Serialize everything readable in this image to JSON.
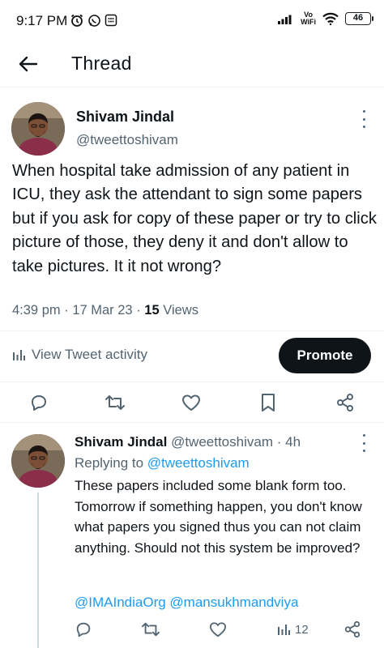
{
  "status_bar": {
    "time": "9:17 PM",
    "volte": "Vo",
    "wifi_label": "WiFi",
    "battery": "46",
    "icons": [
      "alarm-icon",
      "whatsapp-icon",
      "app-notification-icon",
      "signal-icon",
      "wifi-icon",
      "battery-icon"
    ]
  },
  "header": {
    "title": "Thread",
    "back_icon": "back-arrow-icon"
  },
  "main_tweet": {
    "author_name": "Shivam Jindal",
    "author_handle": "@tweettoshivam",
    "text": "When hospital take admission of any patient in ICU, they ask the attendant to sign some papers but if you ask for copy of these paper or try to click picture of those, they deny it and don't allow to take pictures. It it not wrong?",
    "time": "4:39 pm",
    "date": "17 Mar 23",
    "views_count": "15",
    "views_label": "Views",
    "activity_label": "View Tweet activity",
    "promote_label": "Promote",
    "actions": [
      "reply-icon",
      "retweet-icon",
      "like-icon",
      "bookmark-icon",
      "share-icon"
    ]
  },
  "reply_tweet": {
    "author_name": "Shivam Jindal",
    "author_handle": "@tweettoshivam",
    "age": "4h",
    "replying_prefix": "Replying to",
    "replying_handle": "@tweettoshivam",
    "text": "These papers included some blank form too. Tomorrow if something happen, you don't know what papers you signed thus you can not claim anything. Should not this system be improved?",
    "mention_1": "@IMAIndiaOrg",
    "mention_2": "@mansukhmandviya",
    "views_count": "12"
  },
  "colors": {
    "text": "#0f1419",
    "secondary": "#536471",
    "link": "#1d9bf0",
    "divider": "#eff3f4",
    "promote_bg": "#0f1419"
  }
}
